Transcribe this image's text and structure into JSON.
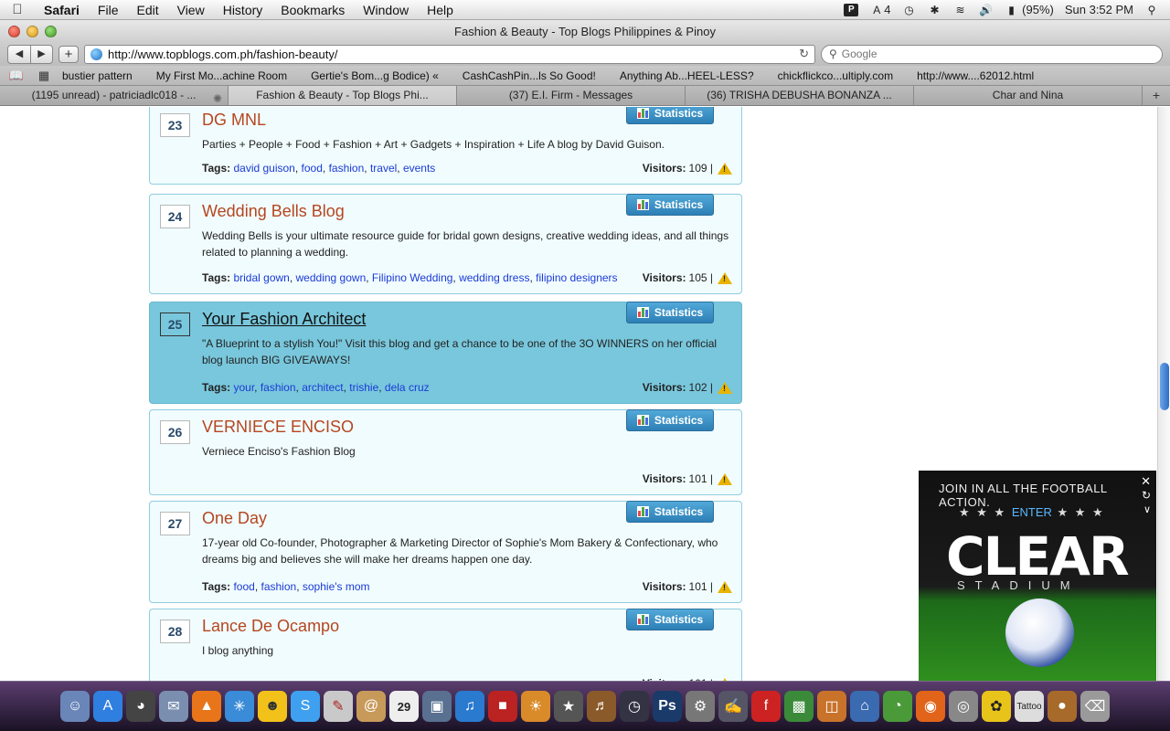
{
  "menubar": {
    "app": "Safari",
    "items": [
      "File",
      "Edit",
      "View",
      "History",
      "Bookmarks",
      "Window",
      "Help"
    ],
    "status_adobe_count": "4",
    "battery": "(95%)",
    "clock": "Sun 3:52 PM"
  },
  "window": {
    "title": "Fashion & Beauty - Top Blogs Philippines & Pinoy"
  },
  "toolbar": {
    "url": "http://www.topblogs.com.ph/fashion-beauty/",
    "search_placeholder": "Google"
  },
  "bookmarks": [
    "bustier pattern",
    "My First Mo...achine Room",
    "Gertie's Bom...g Bodice) «",
    "CashCashPin...ls So Good!",
    "Anything Ab...HEEL-LESS?",
    "chickflickco...ultiply.com",
    "http://www....62012.html"
  ],
  "tabs": [
    "(1195 unread) - patriciadlc018 - ...",
    "Fashion & Beauty - Top Blogs Phi...",
    "(37) E.I. Firm - Messages",
    "(36) TRISHA DEBUSHA BONANZA ...",
    "Char and Nina"
  ],
  "stats_label": "Statistics",
  "tags_label": "Tags:",
  "visitors_label": "Visitors:",
  "entries": [
    {
      "rank": "23",
      "title": "DG MNL",
      "description": "Parties + People + Food + Fashion + Art + Gadgets + Inspiration + Life A blog by David Guison.",
      "tags": [
        "david guison",
        "food",
        "fashion",
        "travel",
        "events"
      ],
      "visitors": "109 |"
    },
    {
      "rank": "24",
      "title": "Wedding Bells Blog",
      "description": "Wedding Bells is your ultimate resource guide for bridal gown designs, creative wedding ideas, and all things related to planning a wedding.",
      "tags": [
        "bridal gown",
        "wedding gown",
        "Filipino Wedding",
        "wedding dress",
        "filipino designers"
      ],
      "visitors": "105 |"
    },
    {
      "rank": "25",
      "title": "Your Fashion Architect",
      "description": "\"A Blueprint to a stylish You!\" Visit this blog and get a chance to be one of the 3O WINNERS on her official blog launch BIG GIVEAWAYS!",
      "tags": [
        "your",
        "fashion",
        "architect",
        "trishie",
        "dela cruz"
      ],
      "visitors": "102 |"
    },
    {
      "rank": "26",
      "title": "VERNIECE ENCISO",
      "description": "Verniece Enciso's Fashion Blog",
      "tags": [],
      "visitors": "101 |"
    },
    {
      "rank": "27",
      "title": "One Day",
      "description": "17-year old Co-founder, Photographer & Marketing Director of Sophie's Mom Bakery & Confectionary, who dreams big and believes she will make her dreams happen one day.",
      "tags": [
        "food",
        "fashion",
        "sophie's mom"
      ],
      "visitors": "101 |"
    },
    {
      "rank": "28",
      "title": "Lance De Ocampo",
      "description": "I blog anything",
      "tags": [],
      "visitors": "101 |"
    }
  ],
  "ad": {
    "headline": "JOIN IN ALL THE FOOTBALL ACTION.",
    "enter": "ENTER",
    "brand": "CLEAR",
    "sub": "STADIUM"
  },
  "dock": {
    "calendar_day": "29",
    "tattoo_label": "Tattoo"
  }
}
